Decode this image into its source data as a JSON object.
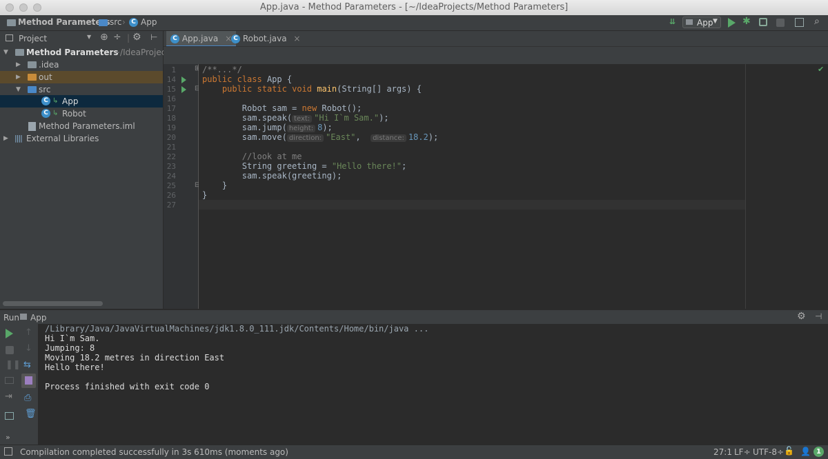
{
  "window": {
    "title": "App.java - Method Parameters - [~/IdeaProjects/Method Parameters]"
  },
  "nav": {
    "crumbs": [
      "Method Parameters",
      "src",
      "App"
    ]
  },
  "toolbar": {
    "run_config": "App"
  },
  "project": {
    "header": "Project",
    "tree": [
      {
        "label": "Method Parameters",
        "suffix": "~/IdeaProjec"
      },
      {
        "label": ".idea"
      },
      {
        "label": "out"
      },
      {
        "label": "src"
      },
      {
        "label": "App"
      },
      {
        "label": "Robot"
      },
      {
        "label": "Method Parameters.iml"
      },
      {
        "label": "External Libraries"
      }
    ]
  },
  "editor": {
    "tabs": [
      {
        "label": "App.java"
      },
      {
        "label": "Robot.java"
      }
    ],
    "line_numbers": [
      "1",
      "14",
      "15",
      "16",
      "17",
      "18",
      "19",
      "20",
      "21",
      "22",
      "23",
      "24",
      "25",
      "26",
      "27"
    ],
    "code": {
      "l1": "/**...*/",
      "kw_public": "public",
      "kw_class": "class",
      "class_name": "App {",
      "kw_static": "static",
      "kw_void": "void",
      "fn_main": "main",
      "main_args": "(String[] args) {",
      "robot_decl": "Robot sam = ",
      "kw_new": "new",
      "robot_ctor": " Robot();",
      "speak_call": "sam.speak(",
      "hint_text": "text:",
      "speak_str": "\"Hi I`m Sam.\"",
      "close_semi": ");",
      "jump_call": "sam.jump(",
      "hint_height": "height:",
      "jump_val": "8",
      "move_call": "sam.move(",
      "hint_direction": "direction:",
      "move_str": "\"East\"",
      "comma": ",",
      "hint_distance": "distance:",
      "move_val": "18.2",
      "comment": "//look at me",
      "greet_decl": "String greeting = ",
      "greet_str": "\"Hello there!\"",
      "semi": ";",
      "speak_greet": "sam.speak(greeting);",
      "close_brace_inner": "}",
      "close_brace_outer": "}"
    }
  },
  "run": {
    "label": "Run",
    "config": "App",
    "output": [
      "/Library/Java/JavaVirtualMachines/jdk1.8.0_111.jdk/Contents/Home/bin/java ...",
      "Hi I`m Sam.",
      "Jumping: 8",
      "Moving 18.2 metres in direction East",
      "Hello there!",
      "",
      "Process finished with exit code 0"
    ]
  },
  "status": {
    "message": "Compilation completed successfully in 3s 610ms (moments ago)",
    "position": "27:1",
    "line_sep": "LF÷",
    "encoding": "UTF-8÷",
    "event_count": "1"
  },
  "colors": {
    "accent": "#4a88c7",
    "run_green": "#59a869",
    "keyword": "#cc7832",
    "string": "#6a8759",
    "number": "#6897bb",
    "function": "#ffc66d"
  }
}
